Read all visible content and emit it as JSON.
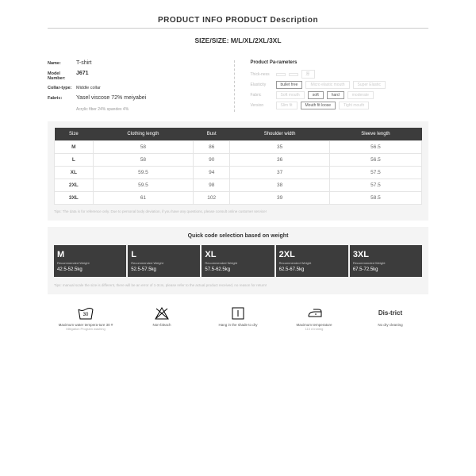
{
  "header": {
    "title": "PRODUCT INFO PRODUCT Description",
    "size_line": "SIZE/SIZE: M/L/XL/2XL/3XL"
  },
  "info": {
    "name_label": "Name:",
    "name_value": "T-shirt",
    "model_label": "Model Number:",
    "model_value": "J671",
    "collar_label": "Collar-type:",
    "collar_value": "Middle collar",
    "fabric_label": "Fabric:",
    "fabric_value": "Yasel viscose 72% meiyabei",
    "composition": "Acrylic fiber 24% spandex 4%"
  },
  "params": {
    "title": "Product Pa-rameters",
    "thickness_label": "Thick-ness",
    "thick_o1": "",
    "thick_o2": "",
    "thick_o3": "厚",
    "elasticity_label": "Elasticity",
    "el_o1": "bullet free",
    "el_o2": "Micro elastic mouth",
    "el_o3": "Super Elastic",
    "fabric_label": "Fabric",
    "fab_o1": "Soft mouth",
    "fab_o2": "soft",
    "fab_o3": "hard",
    "fab_o4": "moderate",
    "version_label": "Version",
    "ver_o1": "Slim fit",
    "ver_o2": "Mouth fit loose",
    "ver_o3": "Tight mouth"
  },
  "table": {
    "headers": [
      "Size",
      "Clothing length",
      "Bust",
      "Shoulder width",
      "Sleeve length"
    ],
    "rows": [
      [
        "M",
        "58",
        "86",
        "35",
        "56.5"
      ],
      [
        "L",
        "58",
        "90",
        "36",
        "56.5"
      ],
      [
        "XL",
        "59.5",
        "94",
        "37",
        "57.5"
      ],
      [
        "2XL",
        "59.5",
        "98",
        "38",
        "57.5"
      ],
      [
        "3XL",
        "61",
        "102",
        "39",
        "58.5"
      ]
    ],
    "tips": "Tips: The data is for reference only. Due to personal body deviation, if you have any questions, please consult online customer service!"
  },
  "weight": {
    "title": "Quick code selection based on weight",
    "label": "Recommended Weight",
    "cards": [
      {
        "size": "M",
        "val": "42.5-52.5kg"
      },
      {
        "size": "L",
        "val": "52.5-57.5kg"
      },
      {
        "size": "XL",
        "val": "57.5-62.5kg"
      },
      {
        "size": "2XL",
        "val": "62.5-67.5kg"
      },
      {
        "size": "3XL",
        "val": "67.5-72.5kg"
      }
    ],
    "tips": "Tips: manual scale the size is different, there will be an error of 1-3cm, please refer to the actual product received, no reason for return!"
  },
  "care": {
    "wash_label": "Maximum water tempera-ture 30 #",
    "wash_sub": "Mitigation Program washing",
    "bleach_label": "Non-bleach",
    "dry_label": "Hang in the shade to dry",
    "iron_label": "Maximum temperature",
    "iron_sub": "110 # ironing",
    "clean_title": "Dis-trict",
    "clean_label": "No dry cleaning"
  }
}
